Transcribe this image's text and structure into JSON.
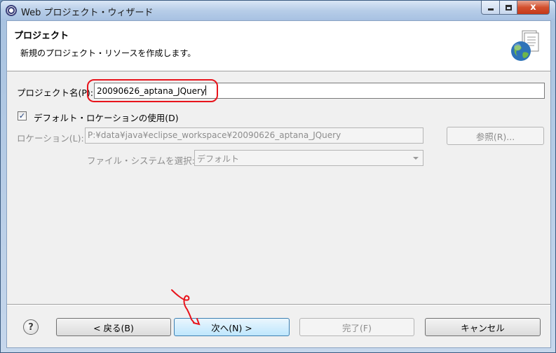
{
  "window": {
    "title": "Web プロジェクト・ウィザード",
    "close_glyph": "x"
  },
  "header": {
    "title": "プロジェクト",
    "description": "新規のプロジェクト・リソースを作成します。",
    "icon": "new-web-project-globe-icon"
  },
  "form": {
    "project_name_label": "プロジェクト名(P):",
    "project_name_value": "20090626_aptana_JQuery",
    "default_location_checked": true,
    "checkbox_mark": "✓",
    "default_location_label": "デフォルト・ロケーションの使用(D)",
    "location_label": "ロケーション(L):",
    "location_value": "P:¥data¥java¥eclipse_workspace¥20090626_aptana_JQuery",
    "browse_label": "参照(R)...",
    "filesystem_label": "ファイル・システムを選択:",
    "filesystem_value": "デフォルト"
  },
  "footer": {
    "help_glyph": "?",
    "back_label": "< 戻る(B)",
    "next_label": "次へ(N) >",
    "finish_label": "完了(F)",
    "cancel_label": "キャンセル"
  },
  "colors": {
    "annotation_red": "#e8141c"
  }
}
